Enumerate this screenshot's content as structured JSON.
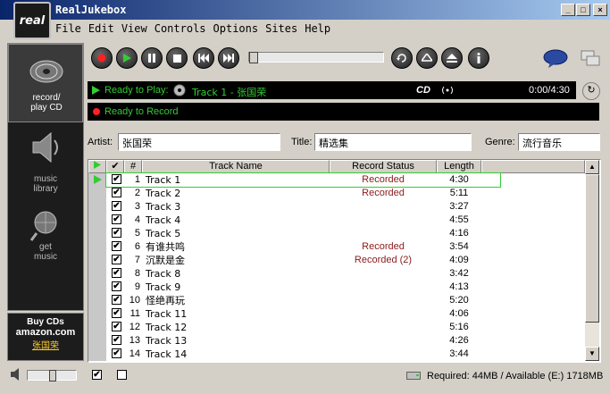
{
  "window": {
    "title": "RealJukebox",
    "logo": "real"
  },
  "menus": [
    {
      "label": "File",
      "key": "F"
    },
    {
      "label": "Edit",
      "key": "E"
    },
    {
      "label": "View",
      "key": "V"
    },
    {
      "label": "Controls",
      "key": "C"
    },
    {
      "label": "Options",
      "key": "O"
    },
    {
      "label": "Sites",
      "key": "S"
    },
    {
      "label": "Help",
      "key": "H"
    }
  ],
  "nav": {
    "record": {
      "line1": "record/",
      "line2": "play CD"
    },
    "library": {
      "line1": "music",
      "line2": "library"
    },
    "get": {
      "line1": "get",
      "line2": "music"
    },
    "amazon": {
      "line1": "Buy CDs",
      "line2": "amazon.com",
      "line3": "张国荣"
    }
  },
  "display": {
    "ready_play": "Ready to Play:",
    "track_now": "Track 1 - 张国荣",
    "media": "CD",
    "time": "0:00/4:30",
    "ready_record": "Ready to Record"
  },
  "fields": {
    "artist_label": "Artist:",
    "artist": "张国荣",
    "title_label": "Title:",
    "title": "精选集",
    "genre_label": "Genre:",
    "genre": "流行音乐"
  },
  "columns": {
    "num": "#",
    "name": "Track Name",
    "status": "Record Status",
    "length": "Length"
  },
  "tracks": [
    {
      "n": "1",
      "name": "Track 1",
      "status": "Recorded",
      "len": "4:30"
    },
    {
      "n": "2",
      "name": "Track 2",
      "status": "Recorded",
      "len": "5:11"
    },
    {
      "n": "3",
      "name": "Track 3",
      "status": "",
      "len": "3:27"
    },
    {
      "n": "4",
      "name": "Track 4",
      "status": "",
      "len": "4:55"
    },
    {
      "n": "5",
      "name": "Track 5",
      "status": "",
      "len": "4:16"
    },
    {
      "n": "6",
      "name": "有谁共鸣",
      "status": "Recorded",
      "len": "3:54"
    },
    {
      "n": "7",
      "name": "沉默是金",
      "status": "Recorded (2)",
      "len": "4:09"
    },
    {
      "n": "8",
      "name": "Track 8",
      "status": "",
      "len": "3:42"
    },
    {
      "n": "9",
      "name": "Track 9",
      "status": "",
      "len": "4:13"
    },
    {
      "n": "10",
      "name": "怪绝再玩",
      "status": "",
      "len": "5:20"
    },
    {
      "n": "11",
      "name": "Track 11",
      "status": "",
      "len": "4:06"
    },
    {
      "n": "12",
      "name": "Track 12",
      "status": "",
      "len": "5:16"
    },
    {
      "n": "13",
      "name": "Track 13",
      "status": "",
      "len": "4:26"
    },
    {
      "n": "14",
      "name": "Track 14",
      "status": "",
      "len": "3:44"
    }
  ],
  "footer": {
    "storage": "Required: 44MB / Available (E:) 1718MB"
  },
  "colors": {
    "accent_green": "#33cc33",
    "recorded_text": "#8b1a1a",
    "record_red": "#ff2020"
  }
}
